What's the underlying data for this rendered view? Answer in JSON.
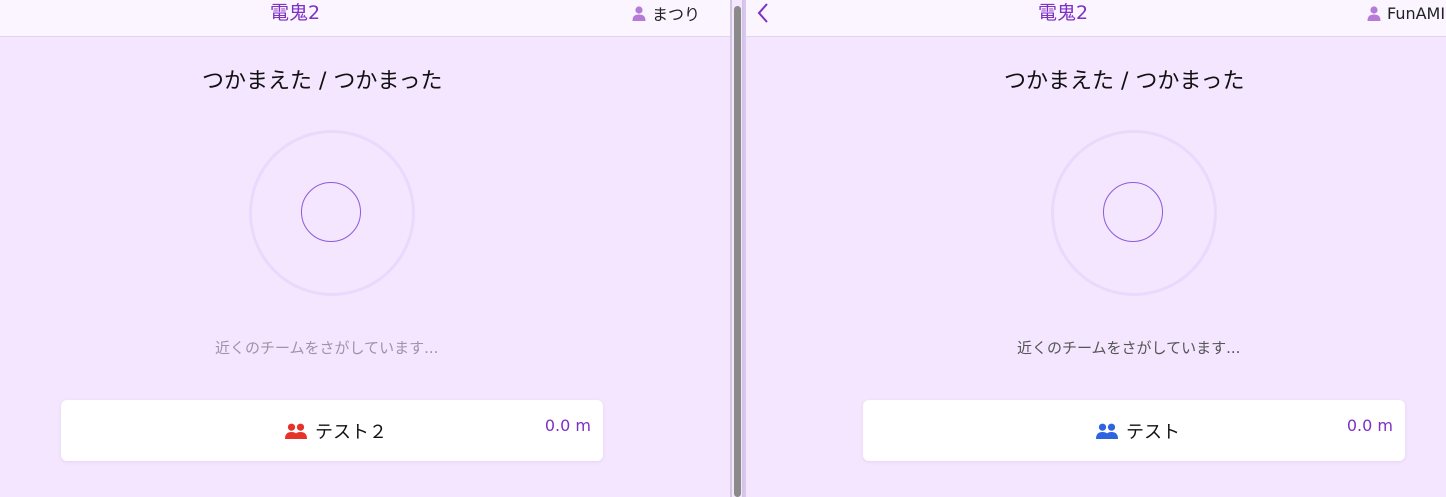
{
  "colors": {
    "background": "#f4e6fe",
    "header_bg": "#faf5ff",
    "accent": "#7e30c4",
    "user_icon": "#b57bd6",
    "team_red": "#e5332a",
    "team_blue": "#2f63e0",
    "status_left": "#9e94a8",
    "status_right": "#555555"
  },
  "left": {
    "header": {
      "title": "電鬼2",
      "username": "まつり",
      "user_icon": "person-icon"
    },
    "heading": "つかまえた / つかまった",
    "status_text": "近くのチームをさがしています...",
    "team": {
      "name": "テスト２",
      "icon": "team-icon",
      "distance": "0.0 m"
    }
  },
  "right": {
    "header": {
      "title": "電鬼2",
      "username": "FunAMI",
      "user_icon": "person-icon",
      "back_icon": "chevron-left-icon"
    },
    "heading": "つかまえた / つかまった",
    "status_text": "近くのチームをさがしています...",
    "team": {
      "name": "テスト",
      "icon": "team-icon",
      "distance": "0.0 m"
    }
  }
}
